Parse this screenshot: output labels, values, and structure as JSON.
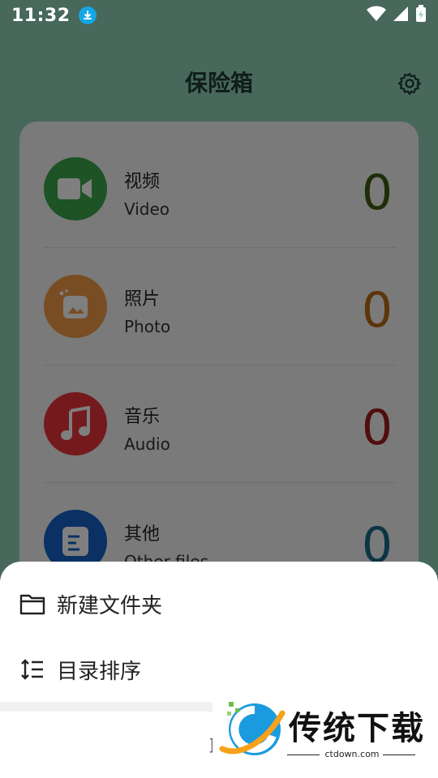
{
  "status_bar": {
    "time": "11:32"
  },
  "header": {
    "title": "保险箱"
  },
  "categories": [
    {
      "name_cn": "视频",
      "name_en": "Video",
      "count": "0",
      "icon": "video-camera-icon",
      "color": "#3aa64a",
      "count_color": "#3d5c10"
    },
    {
      "name_cn": "照片",
      "name_en": "Photo",
      "count": "0",
      "icon": "photo-icon",
      "color": "#f39a47",
      "count_color": "#b86a12"
    },
    {
      "name_cn": "音乐",
      "name_en": "Audio",
      "count": "0",
      "icon": "music-note-icon",
      "color": "#e8353a",
      "count_color": "#a01c1c"
    },
    {
      "name_cn": "其他",
      "name_en": "Other files",
      "count": "0",
      "icon": "document-icon",
      "color": "#1560c8",
      "count_color": "#1a6a8a"
    }
  ],
  "sheet": {
    "items": [
      {
        "label": "新建文件夹",
        "icon": "folder-icon"
      },
      {
        "label": "目录排序",
        "icon": "sort-icon"
      }
    ],
    "cancel": "取"
  },
  "watermark": {
    "name": "传统下载",
    "domain": "ctdown.com"
  }
}
